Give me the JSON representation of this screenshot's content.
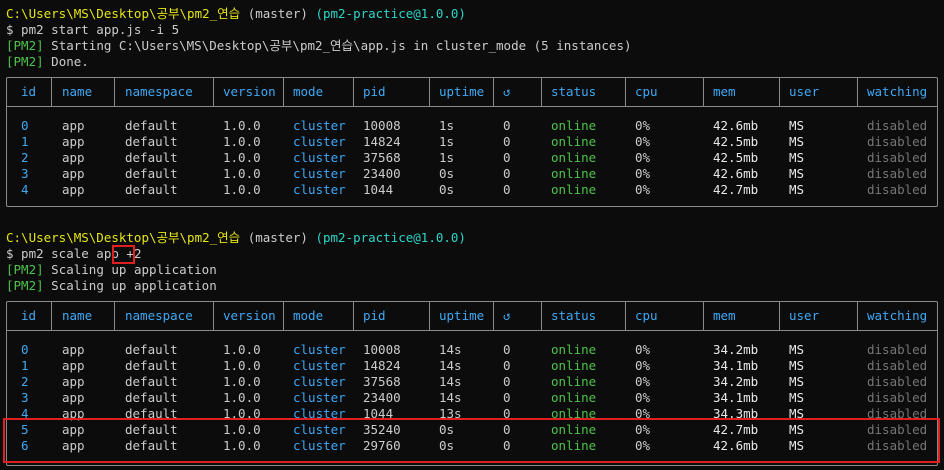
{
  "block1": {
    "prompt_path": "C:\\Users\\MS\\Desktop\\공부\\pm2_연습",
    "prompt_branch": "(master)",
    "prompt_pkg": "(pm2-practice@1.0.0)",
    "command": "$ pm2 start app.js -i 5",
    "logs": [
      {
        "tag": "[PM2]",
        "text": "Starting C:\\Users\\MS\\Desktop\\공부\\pm2_연습\\app.js in cluster_mode (5 instances)"
      },
      {
        "tag": "[PM2]",
        "text": "Done."
      }
    ]
  },
  "block2": {
    "prompt_path": "C:\\Users\\MS\\Desktop\\공부\\pm2_연습",
    "prompt_branch": "(master)",
    "prompt_pkg": "(pm2-practice@1.0.0)",
    "command_prefix": "$ pm2 scale app ",
    "command_arg": "+2",
    "logs": [
      {
        "tag": "[PM2]",
        "text": "Scaling up application"
      },
      {
        "tag": "[PM2]",
        "text": "Scaling up application"
      }
    ]
  },
  "columns": [
    "id",
    "name",
    "namespace",
    "version",
    "mode",
    "pid",
    "uptime",
    "↺",
    "status",
    "cpu",
    "mem",
    "user",
    "watching"
  ],
  "table1": [
    [
      "0",
      "app",
      "default",
      "1.0.0",
      "cluster",
      "10008",
      "1s",
      "0",
      "online",
      "0%",
      "42.6mb",
      "MS",
      "disabled"
    ],
    [
      "1",
      "app",
      "default",
      "1.0.0",
      "cluster",
      "14824",
      "1s",
      "0",
      "online",
      "0%",
      "42.5mb",
      "MS",
      "disabled"
    ],
    [
      "2",
      "app",
      "default",
      "1.0.0",
      "cluster",
      "37568",
      "1s",
      "0",
      "online",
      "0%",
      "42.5mb",
      "MS",
      "disabled"
    ],
    [
      "3",
      "app",
      "default",
      "1.0.0",
      "cluster",
      "23400",
      "0s",
      "0",
      "online",
      "0%",
      "42.6mb",
      "MS",
      "disabled"
    ],
    [
      "4",
      "app",
      "default",
      "1.0.0",
      "cluster",
      "1044",
      "0s",
      "0",
      "online",
      "0%",
      "42.7mb",
      "MS",
      "disabled"
    ]
  ],
  "table2": [
    [
      "0",
      "app",
      "default",
      "1.0.0",
      "cluster",
      "10008",
      "14s",
      "0",
      "online",
      "0%",
      "34.2mb",
      "MS",
      "disabled"
    ],
    [
      "1",
      "app",
      "default",
      "1.0.0",
      "cluster",
      "14824",
      "14s",
      "0",
      "online",
      "0%",
      "34.1mb",
      "MS",
      "disabled"
    ],
    [
      "2",
      "app",
      "default",
      "1.0.0",
      "cluster",
      "37568",
      "14s",
      "0",
      "online",
      "0%",
      "34.2mb",
      "MS",
      "disabled"
    ],
    [
      "3",
      "app",
      "default",
      "1.0.0",
      "cluster",
      "23400",
      "14s",
      "0",
      "online",
      "0%",
      "34.1mb",
      "MS",
      "disabled"
    ],
    [
      "4",
      "app",
      "default",
      "1.0.0",
      "cluster",
      "1044",
      "13s",
      "0",
      "online",
      "0%",
      "34.3mb",
      "MS",
      "disabled"
    ],
    [
      "5",
      "app",
      "default",
      "1.0.0",
      "cluster",
      "35240",
      "0s",
      "0",
      "online",
      "0%",
      "42.7mb",
      "MS",
      "disabled"
    ],
    [
      "6",
      "app",
      "default",
      "1.0.0",
      "cluster",
      "29760",
      "0s",
      "0",
      "online",
      "0%",
      "42.6mb",
      "MS",
      "disabled"
    ]
  ],
  "colors": {
    "background": "#0c0c0c",
    "path": "#e5e510",
    "accent_blue": "#3fa9f5",
    "status_green": "#4ec24e",
    "highlight_red": "#e02020"
  }
}
